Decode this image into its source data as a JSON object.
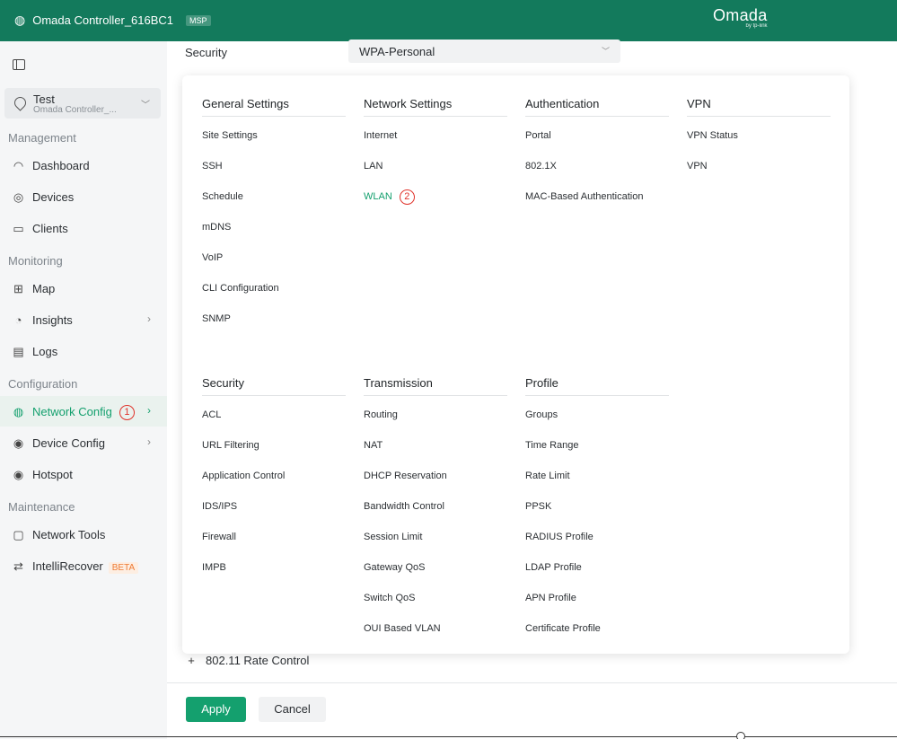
{
  "topbar": {
    "controller": "Omada Controller_616BC1",
    "badge": "MSP",
    "brand": "Omada",
    "brand_sub": "by tp-link"
  },
  "sidebar": {
    "site_name": "Test",
    "site_sub": "Omada Controller_...",
    "sections": {
      "management": "Management",
      "monitoring": "Monitoring",
      "configuration": "Configuration",
      "maintenance": "Maintenance"
    },
    "items": {
      "dashboard": "Dashboard",
      "devices": "Devices",
      "clients": "Clients",
      "map": "Map",
      "insights": "Insights",
      "logs": "Logs",
      "network_config": "Network Config",
      "device_config": "Device Config",
      "hotspot": "Hotspot",
      "network_tools": "Network Tools",
      "intellirecover": "IntelliRecover",
      "beta": "BETA"
    },
    "step1": "1"
  },
  "main": {
    "security_label": "Security",
    "security_value": "WPA-Personal",
    "rate_control": "802.11 Rate Control",
    "apply": "Apply",
    "cancel": "Cancel"
  },
  "menu": {
    "general": {
      "title": "General Settings",
      "items": [
        "Site Settings",
        "SSH",
        "Schedule",
        "mDNS",
        "VoIP",
        "CLI Configuration",
        "SNMP"
      ]
    },
    "network": {
      "title": "Network Settings",
      "items": [
        "Internet",
        "LAN",
        "WLAN"
      ]
    },
    "authentication": {
      "title": "Authentication",
      "items": [
        "Portal",
        "802.1X",
        "MAC-Based Authentication"
      ]
    },
    "vpn": {
      "title": "VPN",
      "items": [
        "VPN Status",
        "VPN"
      ]
    },
    "security": {
      "title": "Security",
      "items": [
        "ACL",
        "URL Filtering",
        "Application Control",
        "IDS/IPS",
        "Firewall",
        "IMPB"
      ]
    },
    "transmission": {
      "title": "Transmission",
      "items": [
        "Routing",
        "NAT",
        "DHCP Reservation",
        "Bandwidth Control",
        "Session Limit",
        "Gateway QoS",
        "Switch QoS",
        "OUI Based VLAN"
      ]
    },
    "profile": {
      "title": "Profile",
      "items": [
        "Groups",
        "Time Range",
        "Rate Limit",
        "PPSK",
        "RADIUS Profile",
        "LDAP Profile",
        "APN Profile",
        "Certificate Profile"
      ]
    },
    "step2": "2"
  }
}
